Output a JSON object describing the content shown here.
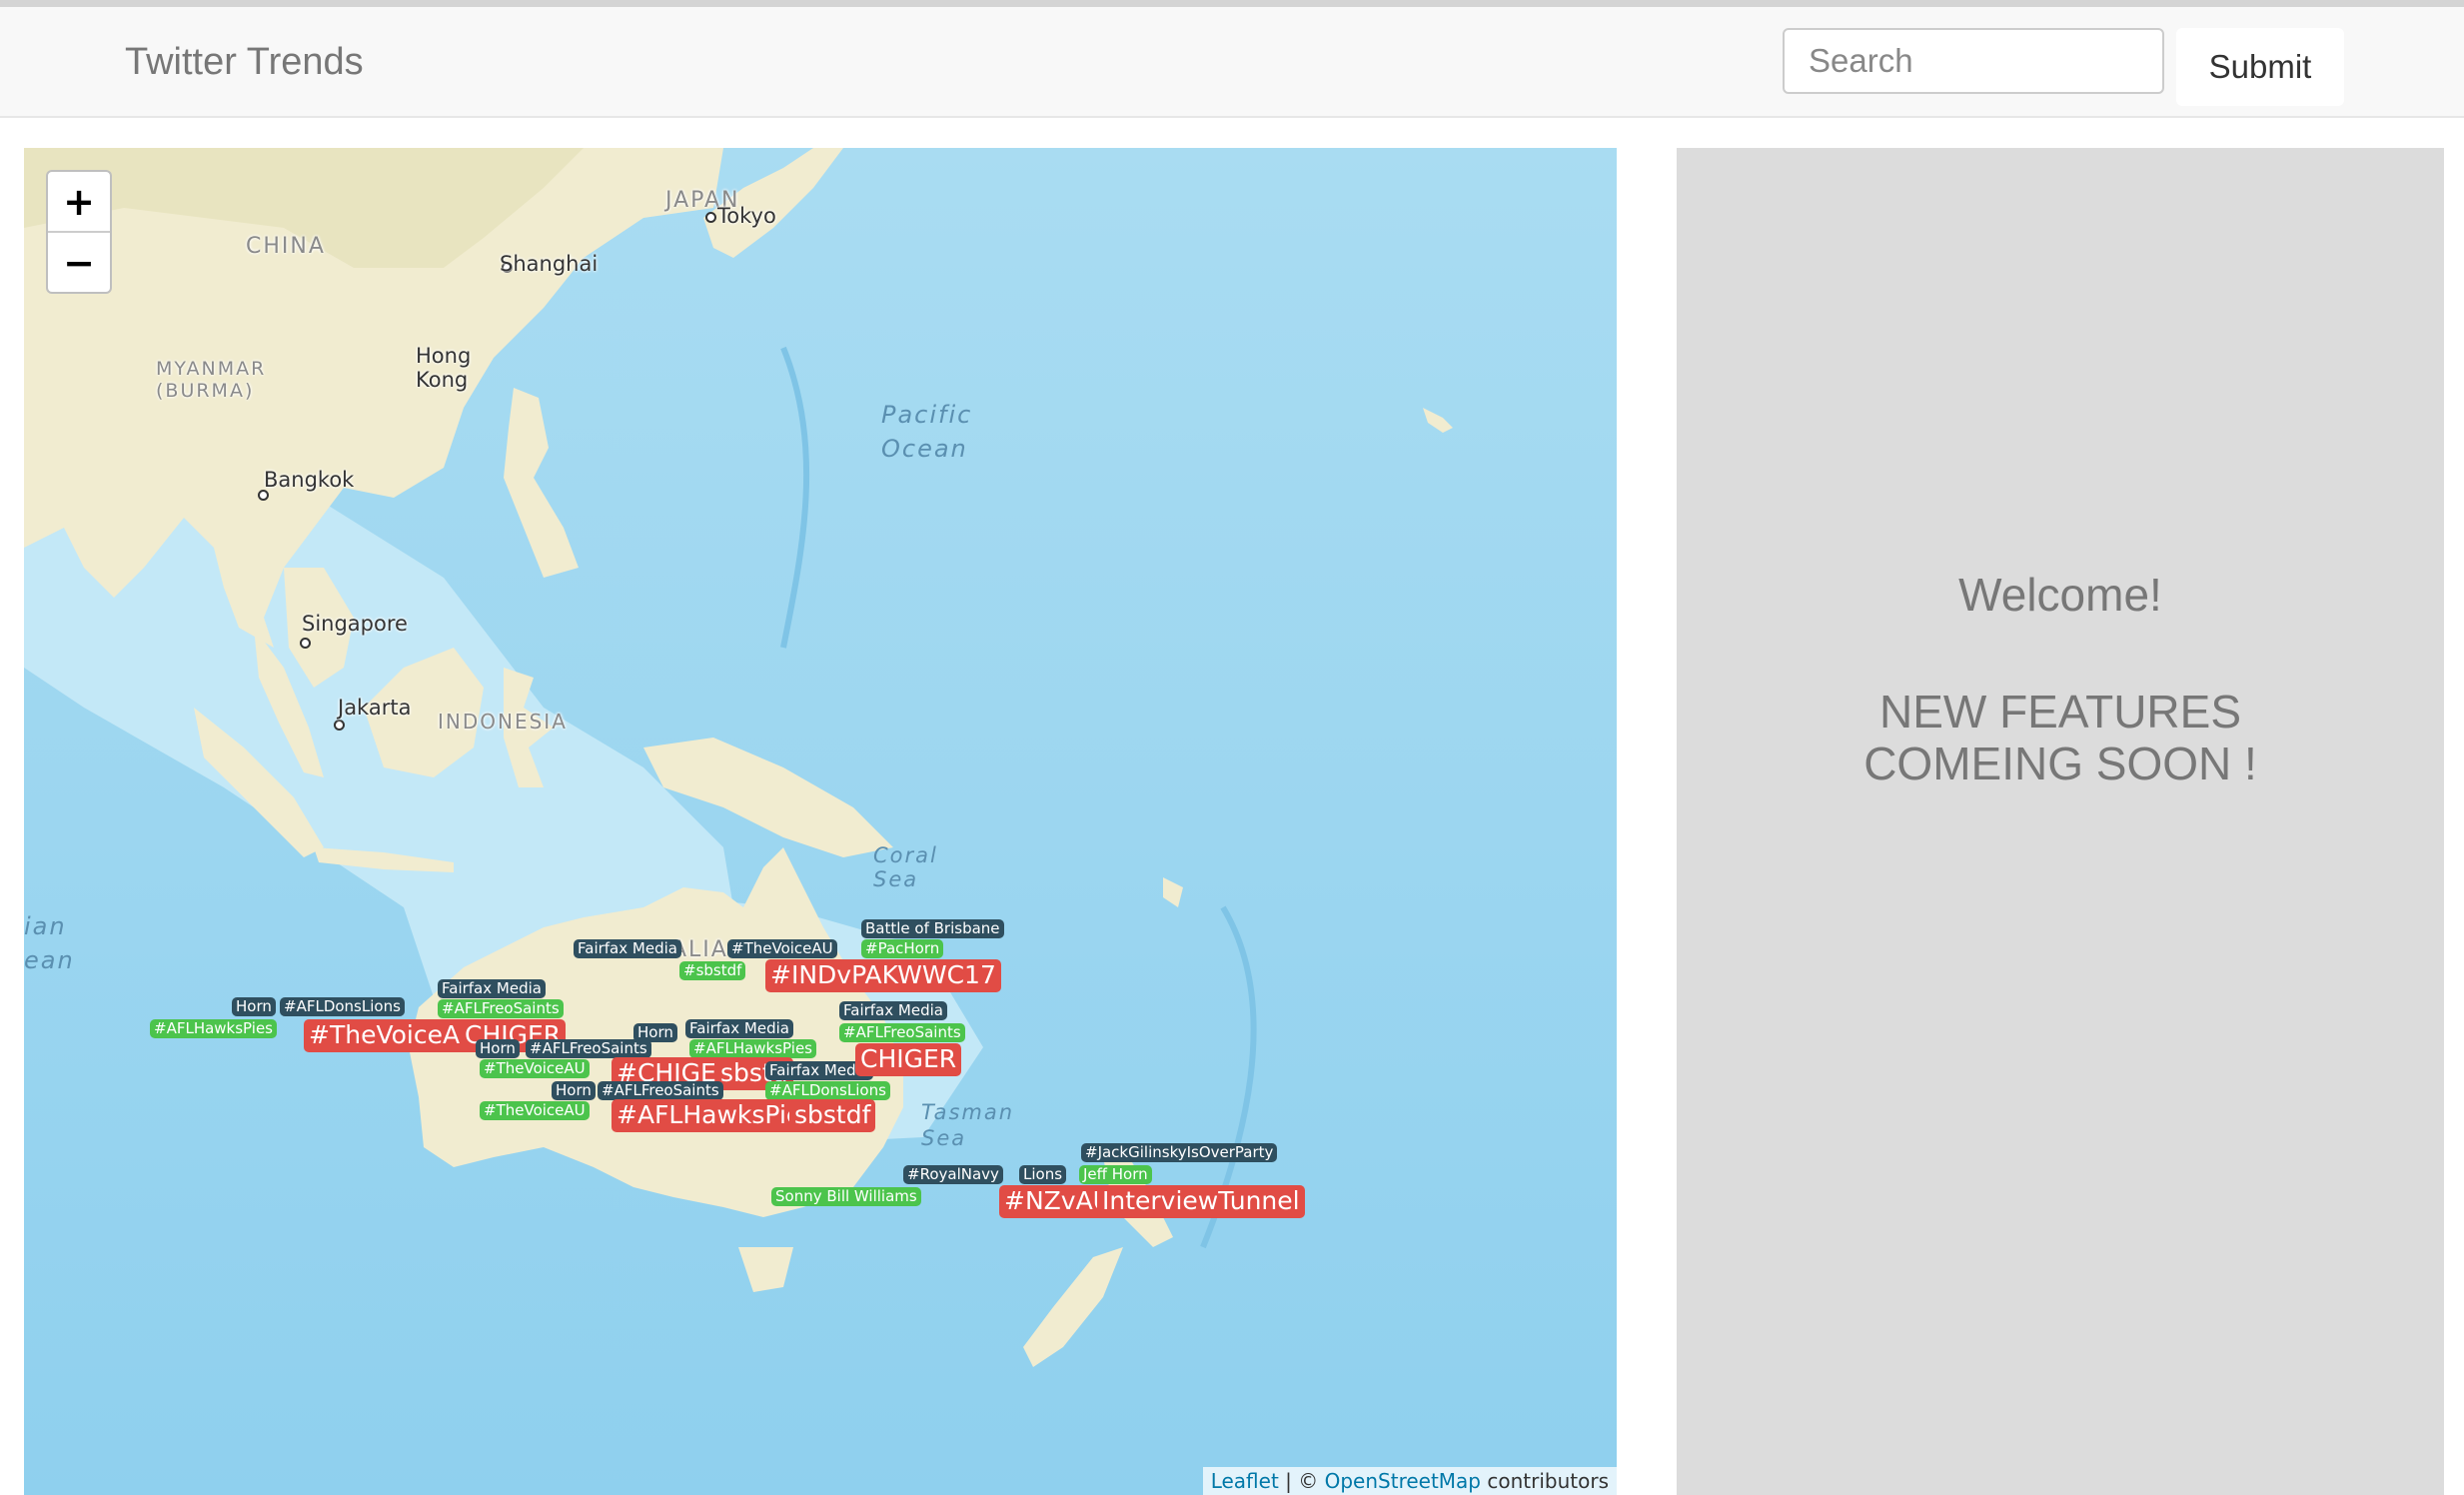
{
  "header": {
    "brand": "Twitter Trends",
    "search_placeholder": "Search",
    "submit_label": "Submit"
  },
  "map": {
    "zoom_in": "+",
    "zoom_out": "−",
    "labels": {
      "china": "CHINA",
      "japan": "JAPAN",
      "tokyo": "Tokyo",
      "shanghai": "Shanghai",
      "hong_kong": "Hong\nKong",
      "myanmar": "MYANMAR\n(BURMA)",
      "bangkok": "Bangkok",
      "singapore": "Singapore",
      "jakarta": "Jakarta",
      "indonesia": "INDONESIA",
      "pacific_ocean": "Pacific\nOcean",
      "coral_sea": "Coral\nSea",
      "tasman_sea": "Tasman\nSea",
      "indian_ocean": "ian\nean",
      "australia": "ALIA"
    },
    "trends": [
      {
        "text": "Battle of Brisbane",
        "style": "d"
      },
      {
        "text": "#PacHorn",
        "style": "g"
      },
      {
        "text": "Fairfax Media",
        "style": "d"
      },
      {
        "text": "#TheVoiceAU",
        "style": "d"
      },
      {
        "text": "#sbstdf",
        "style": "g"
      },
      {
        "text": "#INDvPAKWWC17",
        "style": "r"
      },
      {
        "text": "Fairfax Media",
        "style": "d"
      },
      {
        "text": "#AFLFreoSaints",
        "style": "g"
      },
      {
        "text": "Horn",
        "style": "d"
      },
      {
        "text": "#AFLDonsLions",
        "style": "d"
      },
      {
        "text": "#AFLHawksPies",
        "style": "g"
      },
      {
        "text": "#TheVoiceAU",
        "style": "r"
      },
      {
        "text": "CHIGER",
        "style": "r"
      },
      {
        "text": "Fairfax Media",
        "style": "d"
      },
      {
        "text": "#AFLFreoSaints",
        "style": "g"
      },
      {
        "text": "Horn",
        "style": "d"
      },
      {
        "text": "#AFLFreoSaints",
        "style": "d"
      },
      {
        "text": "Horn",
        "style": "d"
      },
      {
        "text": "Fairfax Media",
        "style": "d"
      },
      {
        "text": "#AFLHawksPies",
        "style": "g"
      },
      {
        "text": "#TheVoiceAU",
        "style": "g"
      },
      {
        "text": "#CHIGER",
        "style": "r"
      },
      {
        "text": "sbstd",
        "style": "r"
      },
      {
        "text": "Fairfax Media",
        "style": "d"
      },
      {
        "text": "CHIGER",
        "style": "r"
      },
      {
        "text": "Horn",
        "style": "d"
      },
      {
        "text": "#AFLFreoSaints",
        "style": "d"
      },
      {
        "text": "#AFLDonsLions",
        "style": "g"
      },
      {
        "text": "#TheVoiceAU",
        "style": "g"
      },
      {
        "text": "#AFLHawksPies",
        "style": "r"
      },
      {
        "text": "sbstdf",
        "style": "r"
      },
      {
        "text": "#JackGilinskyIsOverParty",
        "style": "d"
      },
      {
        "text": "#RoyalNavy",
        "style": "d"
      },
      {
        "text": "Lions",
        "style": "d"
      },
      {
        "text": "Jeff Horn",
        "style": "g"
      },
      {
        "text": "Sonny Bill Williams",
        "style": "g"
      },
      {
        "text": "#NZvAUS",
        "style": "r"
      },
      {
        "text": "InterviewTunnel",
        "style": "r"
      }
    ],
    "attribution": {
      "leaflet": "Leaflet",
      "sep": " | © ",
      "osm": "OpenStreetMap",
      "contributors": " contributors"
    }
  },
  "panel": {
    "welcome": "Welcome!",
    "features": "NEW FEATURES\nCOMEING SOON !"
  }
}
